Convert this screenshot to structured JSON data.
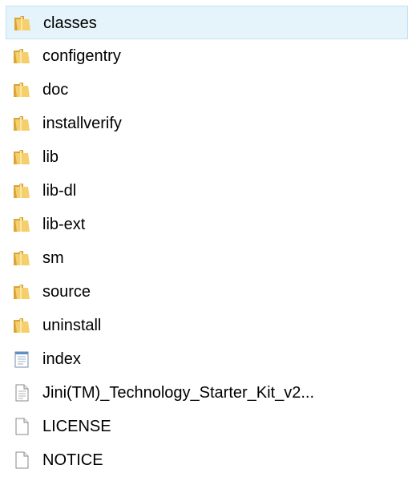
{
  "items": [
    {
      "name": "classes",
      "type": "folder",
      "selected": true
    },
    {
      "name": "configentry",
      "type": "folder",
      "selected": false
    },
    {
      "name": "doc",
      "type": "folder",
      "selected": false
    },
    {
      "name": "installverify",
      "type": "folder",
      "selected": false
    },
    {
      "name": "lib",
      "type": "folder",
      "selected": false
    },
    {
      "name": "lib-dl",
      "type": "folder",
      "selected": false
    },
    {
      "name": "lib-ext",
      "type": "folder",
      "selected": false
    },
    {
      "name": "sm",
      "type": "folder",
      "selected": false
    },
    {
      "name": "source",
      "type": "folder",
      "selected": false
    },
    {
      "name": "uninstall",
      "type": "folder",
      "selected": false
    },
    {
      "name": "index",
      "type": "notepad-file",
      "selected": false
    },
    {
      "name": "Jini(TM)_Technology_Starter_Kit_v2...",
      "type": "text-file",
      "selected": false
    },
    {
      "name": "LICENSE",
      "type": "blank-file",
      "selected": false
    },
    {
      "name": "NOTICE",
      "type": "blank-file",
      "selected": false
    }
  ],
  "colors": {
    "selection_background": "#e5f3fb",
    "selection_border": "#c2e1f5",
    "folder": "#e8b64c",
    "text": "#000000"
  }
}
